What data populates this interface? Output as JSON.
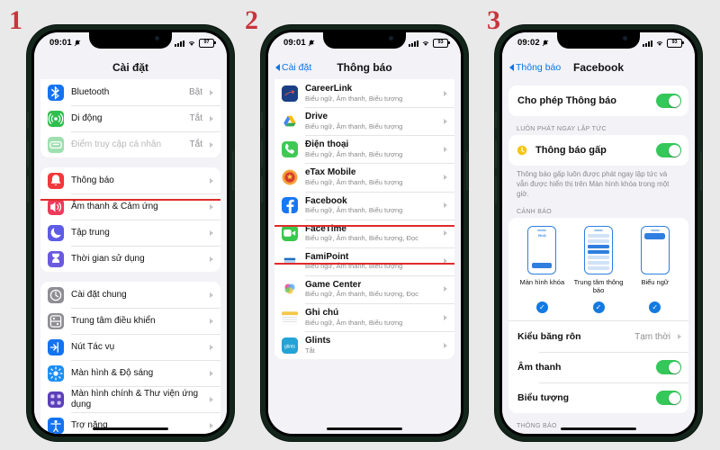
{
  "steps": [
    {
      "num": "1"
    },
    {
      "num": "2"
    },
    {
      "num": "3"
    }
  ],
  "colors": {
    "accent_blue": "#0a74e8",
    "highlight_red": "#e02b2b",
    "toggle_green": "#34c759",
    "step_number_red": "#c8353c",
    "page_background": "#e9e9e9"
  },
  "phone1": {
    "status": {
      "time": "09:01",
      "silent_icon": "bell-slash-icon",
      "signal_icon": "cellular-bars-icon",
      "wifi_icon": "wifi-icon",
      "battery": "97"
    },
    "nav": {
      "title": "Cài đặt"
    },
    "group1": [
      {
        "label": "Bluetooth",
        "value": "Bật",
        "icon": "bluetooth-icon",
        "dim": false
      },
      {
        "label": "Di động",
        "value": "Tắt",
        "icon": "cellular-icon",
        "dim": false
      },
      {
        "label": "Điểm truy cập cá nhân",
        "value": "Tắt",
        "icon": "hotspot-icon",
        "dim": true
      }
    ],
    "group2": [
      {
        "label": "Thông báo",
        "icon": "notifications-icon",
        "highlighted": true
      },
      {
        "label": "Âm thanh & Cảm ứng",
        "icon": "sounds-icon",
        "highlighted": false
      },
      {
        "label": "Tập trung",
        "icon": "focus-icon",
        "highlighted": false
      },
      {
        "label": "Thời gian sử dụng",
        "icon": "screentime-icon",
        "highlighted": false
      }
    ],
    "group3": [
      {
        "label": "Cài đặt chung",
        "icon": "general-icon"
      },
      {
        "label": "Trung tâm điều khiển",
        "icon": "control-center-icon"
      },
      {
        "label": "Nút Tác vụ",
        "icon": "action-button-icon"
      },
      {
        "label": "Màn hình & Độ sáng",
        "icon": "display-brightness-icon"
      },
      {
        "label": "Màn hình chính & Thư viện ứng dụng",
        "icon": "home-screen-icon"
      },
      {
        "label": "Trợ năng",
        "icon": "accessibility-icon"
      }
    ]
  },
  "phone2": {
    "status": {
      "time": "09:01",
      "battery": "93"
    },
    "nav": {
      "back": "Cài đặt",
      "title": "Thông báo"
    },
    "apps": [
      {
        "name": "CareerLink",
        "sub": "Biểu ngữ, Âm thanh, Biểu tượng",
        "icon": "careerlink-icon",
        "highlighted": false
      },
      {
        "name": "Drive",
        "sub": "Biểu ngữ, Âm thanh, Biểu tượng",
        "icon": "drive-icon",
        "highlighted": false
      },
      {
        "name": "Điện thoại",
        "sub": "Biểu ngữ, Âm thanh, Biểu tượng",
        "icon": "phone-icon",
        "highlighted": false
      },
      {
        "name": "eTax Mobile",
        "sub": "Biểu ngữ, Âm thanh, Biểu tượng",
        "icon": "etax-icon",
        "highlighted": false
      },
      {
        "name": "Facebook",
        "sub": "Biểu ngữ, Âm thanh, Biểu tượng",
        "icon": "facebook-icon",
        "highlighted": true
      },
      {
        "name": "FaceTime",
        "sub": "Biểu ngữ, Âm thanh, Biểu tượng, Đọc",
        "icon": "facetime-icon",
        "highlighted": false
      },
      {
        "name": "FamiPoint",
        "sub": "Biểu ngữ, Âm thanh, Biểu tượng",
        "icon": "famipoint-icon",
        "highlighted": false
      },
      {
        "name": "Game Center",
        "sub": "Biểu ngữ, Âm thanh, Biểu tượng, Đọc",
        "icon": "game-center-icon",
        "highlighted": false
      },
      {
        "name": "Ghi chú",
        "sub": "Biểu ngữ, Âm thanh, Biểu tượng",
        "icon": "notes-icon",
        "highlighted": false
      },
      {
        "name": "Glints",
        "sub": "Tắt",
        "icon": "glints-icon",
        "highlighted": false
      }
    ]
  },
  "phone3": {
    "status": {
      "time": "09:02",
      "battery": "93"
    },
    "nav": {
      "back": "Thông báo",
      "title": "Facebook"
    },
    "allow": {
      "label": "Cho phép Thông báo",
      "toggle": "on"
    },
    "section_immediate": {
      "header": "LUÔN PHÁT NGAY LẬP TỨC",
      "row_label": "Thông báo gấp",
      "row_icon": "time-sensitive-icon",
      "toggle": "on",
      "note": "Thông báo gấp luôn được phát ngay lập tức và vẫn được hiển thị trên Màn hình khóa trong một giờ."
    },
    "section_alerts": {
      "header": "CẢNH BÁO",
      "options": [
        {
          "caption": "Màn hình khóa",
          "icon": "lock-screen-preview-icon",
          "checked": true,
          "mini_time": "09:41"
        },
        {
          "caption": "Trung tâm thông báo",
          "icon": "notification-center-preview-icon",
          "checked": true
        },
        {
          "caption": "Biểu ngữ",
          "icon": "banner-preview-icon",
          "checked": true
        }
      ],
      "rows": [
        {
          "label": "Kiểu băng rôn",
          "value": "Tạm thời",
          "type": "chevron"
        },
        {
          "label": "Âm thanh",
          "type": "toggle",
          "toggle": "on"
        },
        {
          "label": "Biểu tượng",
          "type": "toggle",
          "toggle": "on"
        }
      ]
    },
    "section_bottom": {
      "header": "THÔNG BÁO"
    }
  }
}
